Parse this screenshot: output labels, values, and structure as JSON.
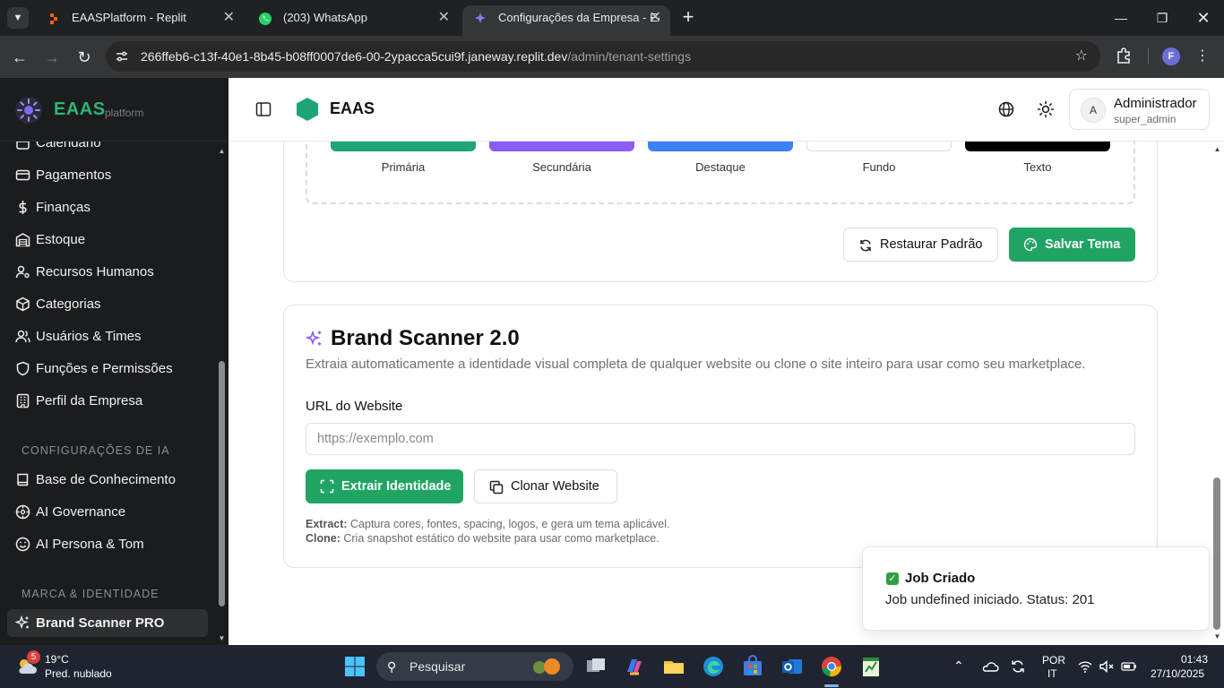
{
  "browser": {
    "tabs": [
      {
        "title": "EAASPlatform - Replit",
        "active": false
      },
      {
        "title": "(203) WhatsApp",
        "active": false
      },
      {
        "title": "Configurações da Empresa - EA",
        "active": true
      }
    ],
    "url_host": "266ffeb6-c13f-40e1-8b45-b08ff0007de6-00-2ypacca5cui9f.janeway.replit.dev",
    "url_path": "/admin/tenant-settings",
    "profile_initial": "F"
  },
  "sidebar": {
    "brand_name": "EAAS",
    "brand_sub": "platform",
    "items": [
      {
        "label": "Calendário",
        "icon": "calendar-icon"
      },
      {
        "label": "Pagamentos",
        "icon": "credit-card-icon"
      },
      {
        "label": "Finanças",
        "icon": "dollar-icon"
      },
      {
        "label": "Estoque",
        "icon": "warehouse-icon"
      },
      {
        "label": "Recursos Humanos",
        "icon": "users-cog-icon"
      },
      {
        "label": "Categorias",
        "icon": "package-icon"
      },
      {
        "label": "Usuários & Times",
        "icon": "users-icon"
      },
      {
        "label": "Funções e Permissões",
        "icon": "shield-icon"
      },
      {
        "label": "Perfil da Empresa",
        "icon": "building-icon"
      }
    ],
    "section_ai": "CONFIGURAÇÕES DE IA",
    "ai_items": [
      {
        "label": "Base de Conhecimento",
        "icon": "book-icon"
      },
      {
        "label": "AI Governance",
        "icon": "compass-icon"
      },
      {
        "label": "AI Persona & Tom",
        "icon": "smile-icon"
      }
    ],
    "section_brand": "MARCA & IDENTIDADE",
    "brand_items": [
      {
        "label": "Brand Scanner PRO",
        "icon": "sparkles-icon",
        "active": true
      }
    ]
  },
  "header": {
    "title": "EAAS",
    "user_initial": "A",
    "user_name": "Administrador",
    "user_role": "super_admin"
  },
  "theme": {
    "swatches": [
      {
        "label": "Primária",
        "color": "#1fa47a"
      },
      {
        "label": "Secundária",
        "color": "#8b5cf6"
      },
      {
        "label": "Destaque",
        "color": "#3b82f6"
      },
      {
        "label": "Fundo",
        "color": "#ffffff"
      },
      {
        "label": "Texto",
        "color": "#000000"
      }
    ],
    "restore_label": "Restaurar Padrão",
    "save_label": "Salvar Tema"
  },
  "scanner": {
    "title": "Brand Scanner 2.0",
    "description": "Extraia automaticamente a identidade visual completa de qualquer website ou clone o site inteiro para usar como seu marketplace.",
    "url_label": "URL do Website",
    "url_placeholder": "https://exemplo.com",
    "extract_label": "Extrair Identidade",
    "clone_label": "Clonar Website",
    "note_extract_key": "Extract:",
    "note_extract_text": " Captura cores, fontes, spacing, logos, e gera um tema aplicável.",
    "note_clone_key": "Clone:",
    "note_clone_text": " Cria snapshot estático do website para usar como marketplace."
  },
  "toast": {
    "title": "Job Criado",
    "body": "Job undefined iniciado. Status: 201"
  },
  "taskbar": {
    "weather_badge": "5",
    "weather_temp": "19°C",
    "weather_desc": "Pred. nublado",
    "search_label": "Pesquisar",
    "lang_line1": "POR",
    "lang_line2": "IT",
    "time": "01:43",
    "date": "27/10/2025"
  },
  "colors": {
    "accent_green": "#1fa463",
    "sidebar_bg": "#1b1c1e"
  }
}
